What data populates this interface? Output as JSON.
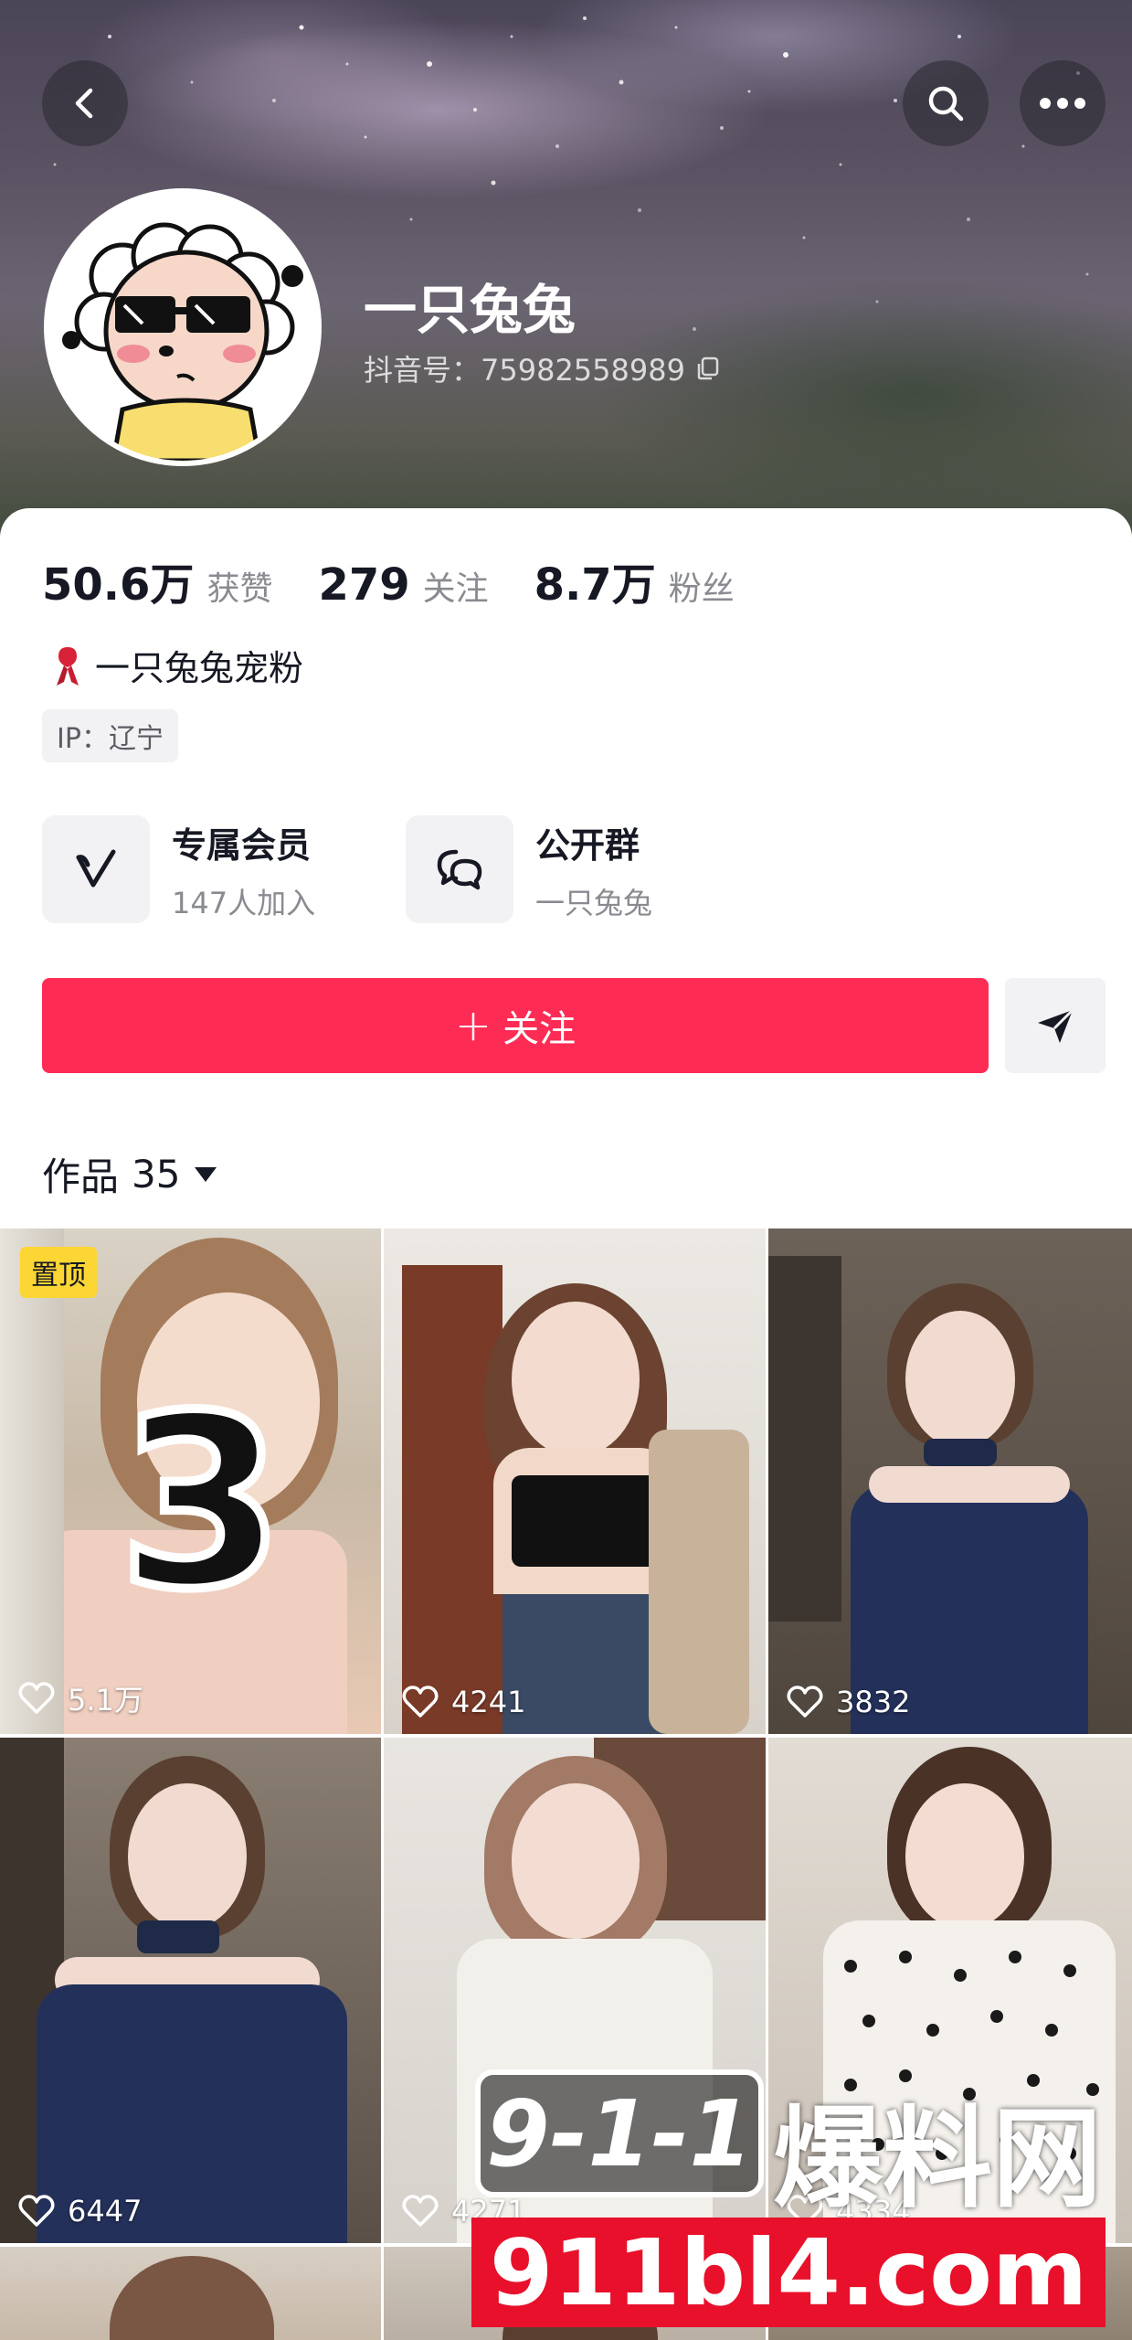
{
  "profile": {
    "nickname": "一只兔兔",
    "douyin_id": "抖音号：75982558989",
    "stats": [
      {
        "value": "50.6万",
        "label": "获赞"
      },
      {
        "value": "279",
        "label": "关注"
      },
      {
        "value": "8.7万",
        "label": "粉丝"
      }
    ],
    "signature": "一只兔兔宠粉",
    "ip_location": "IP：辽宁"
  },
  "features": {
    "member": {
      "title": "专属会员",
      "subtitle": "147人加入"
    },
    "group": {
      "title": "公开群",
      "subtitle": "一只兔兔"
    }
  },
  "actions": {
    "follow_label": "关注",
    "follow_symbol": "+"
  },
  "works": {
    "label": "作品",
    "count": "35"
  },
  "videos": [
    {
      "likes": "5.1万",
      "badge": "置顶",
      "overlay_number": "3"
    },
    {
      "likes": "4241"
    },
    {
      "likes": "3832"
    },
    {
      "likes": "6447"
    },
    {
      "likes": "4271"
    },
    {
      "likes": "4334"
    }
  ],
  "watermark": {
    "logo_text": "9-1-1",
    "site_name": "爆料网",
    "domain": "911bl4.com"
  },
  "colors": {
    "accent": "#fe2c55",
    "pin_badge": "#fbd634",
    "watermark_red": "#e8102a"
  }
}
